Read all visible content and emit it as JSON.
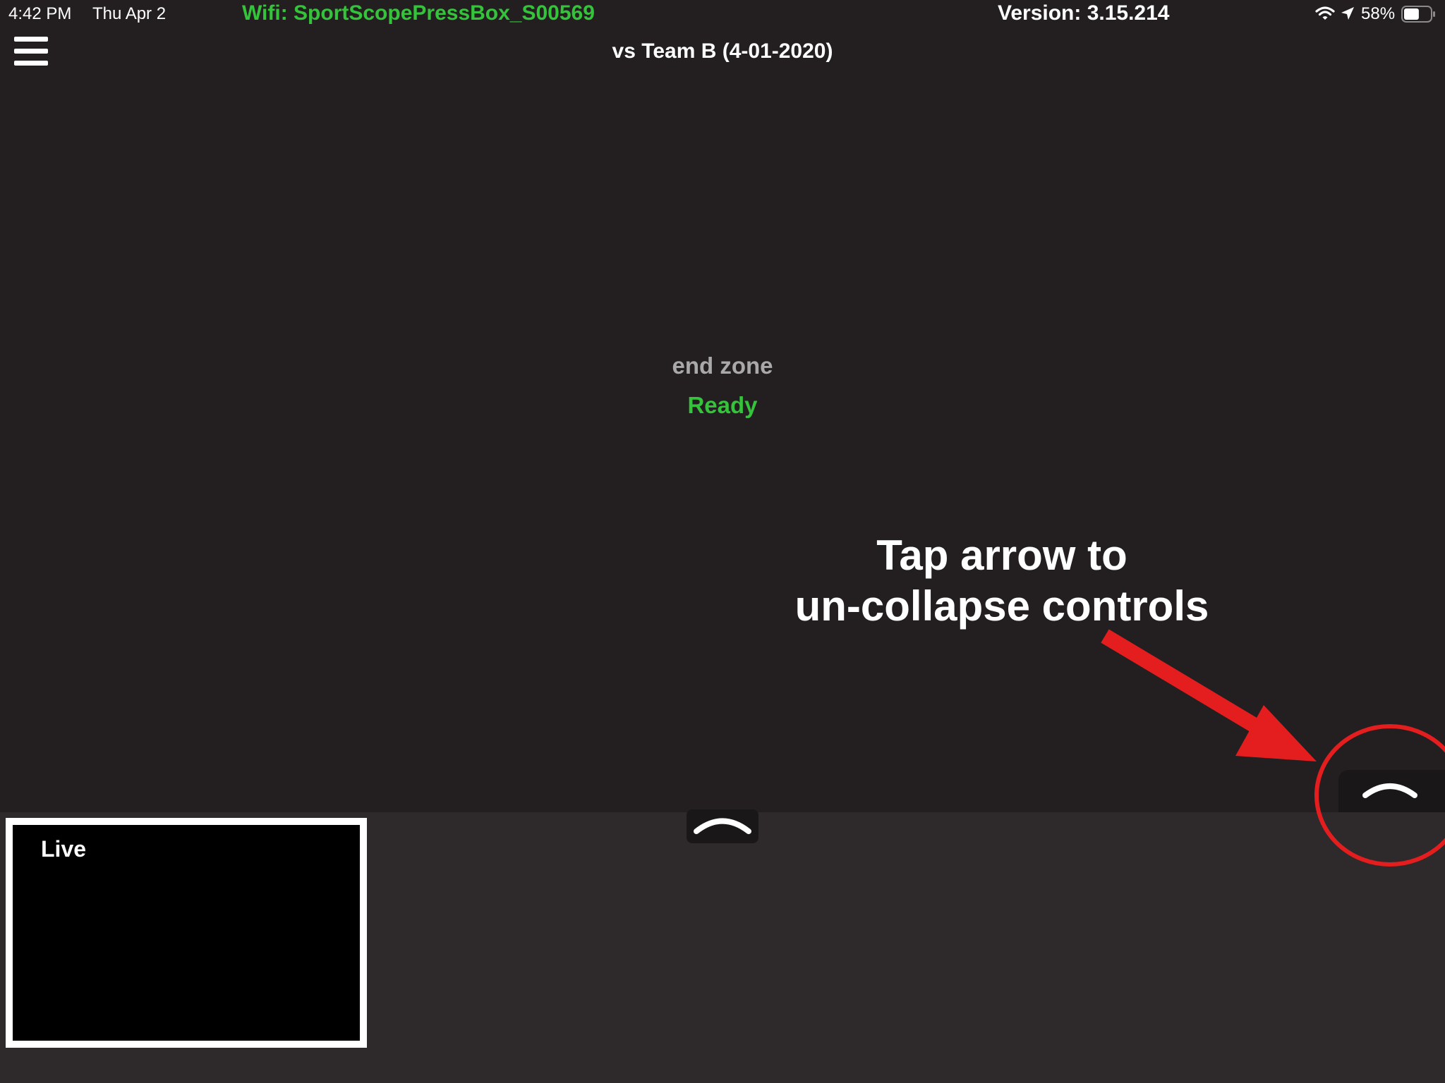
{
  "status_bar": {
    "time": "4:42 PM",
    "date": "Thu Apr 2",
    "wifi_label": "Wifi: SportScopePressBox_S00569",
    "version": "Version: 3.15.214",
    "battery_percent": "58%",
    "battery_level": 0.58,
    "icons": [
      "wifi-icon",
      "location-arrow-icon",
      "battery-icon"
    ]
  },
  "nav": {
    "menu_icon": "hamburger-menu-icon",
    "title": "vs Team B (4-01-2020)"
  },
  "camera": {
    "name": "end zone",
    "status": "Ready"
  },
  "annotation": {
    "line1": "Tap arrow to",
    "line2": "un-collapse controls"
  },
  "controls": {
    "center_tab_icon": "chevron-up-icon",
    "right_tab_icon": "chevron-up-icon"
  },
  "preview": {
    "label": "Live"
  },
  "colors": {
    "background": "#231f20",
    "panel": "#2e2a2b",
    "accent_green": "#34c33a",
    "annotation_red": "#e41e1e"
  }
}
